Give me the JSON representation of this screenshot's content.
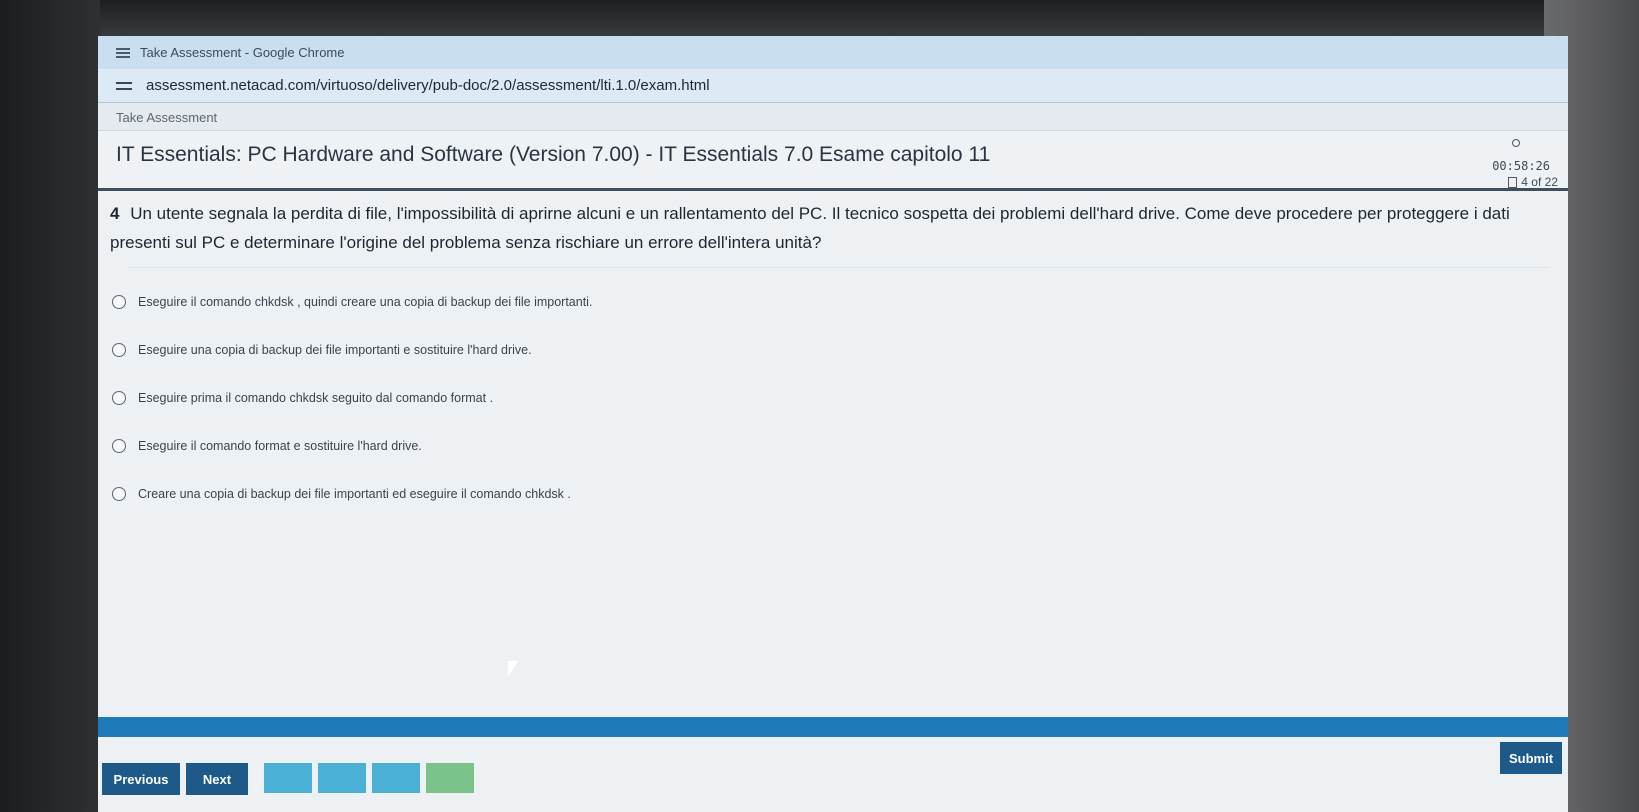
{
  "window": {
    "title": "Take Assessment - Google Chrome",
    "url": "assessment.netacad.com/virtuoso/delivery/pub-doc/2.0/assessment/lti.1.0/exam.html"
  },
  "page": {
    "tab_title": "Take Assessment",
    "exam_title": "IT Essentials: PC Hardware and Software (Version 7.00) - IT Essentials 7.0 Esame capitolo 11",
    "timer": "00:58:26",
    "progress": "4 of 22"
  },
  "question": {
    "number": "4",
    "text": "Un utente segnala la perdita di file, l'impossibilità di aprirne alcuni e un rallentamento del PC. Il tecnico sospetta dei problemi dell'hard drive. Come deve procedere per proteggere i dati presenti sul PC e determinare l'origine del problema senza rischiare un errore dell'intera unità?",
    "options": [
      "Eseguire il comando chkdsk , quindi creare una copia di backup dei file importanti.",
      "Eseguire una copia di backup dei file importanti e sostituire l'hard drive.",
      "Eseguire prima il comando chkdsk seguito dal comando format .",
      "Eseguire il comando format e sostituire l'hard drive.",
      "Creare una copia di backup dei file importanti ed eseguire il comando chkdsk ."
    ]
  },
  "navigation": {
    "previous_label": "Previous",
    "next_label": "Next",
    "submit_label": "Submit"
  },
  "colors": {
    "accent": "#1e7ab8",
    "button": "#1d5a8a",
    "question_box": "#4ab0d6",
    "answered_box": "#7cc28b"
  }
}
